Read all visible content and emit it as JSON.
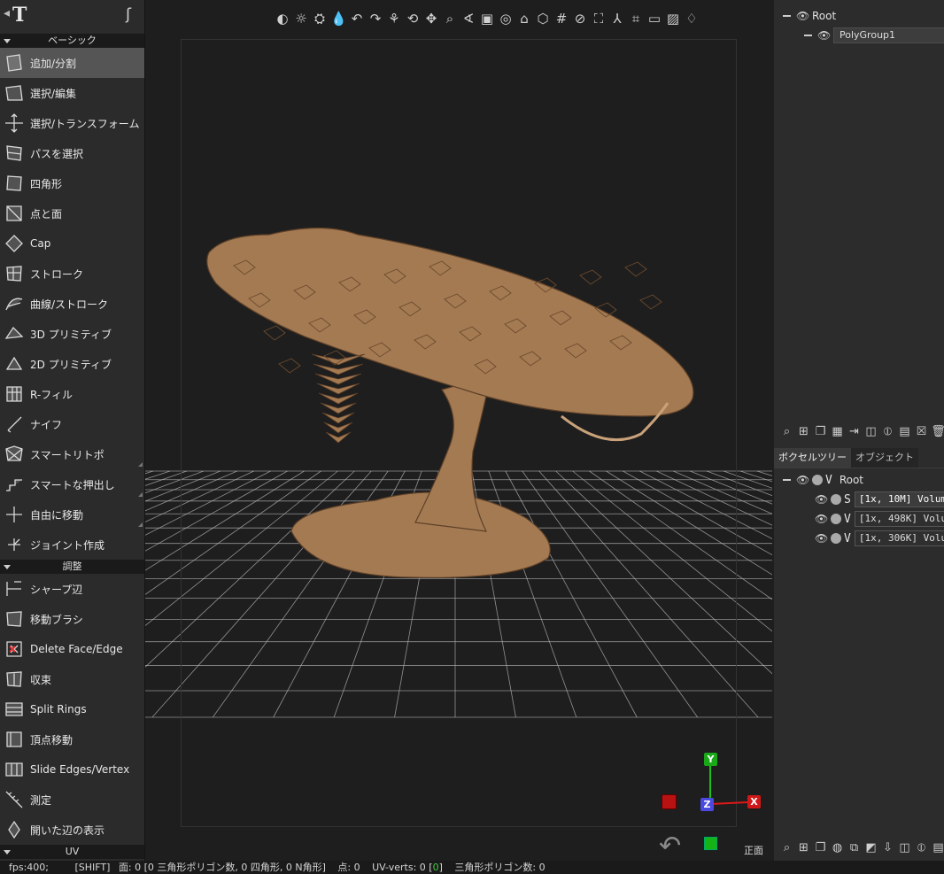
{
  "left_panel": {
    "sections": [
      {
        "title": "ベーシック",
        "tools": [
          {
            "label": "追加/分割",
            "icon": "add-split-icon",
            "active": true
          },
          {
            "label": "選択/編集",
            "icon": "select-edit-icon"
          },
          {
            "label": "選択/トランスフォーム",
            "icon": "transform-icon"
          },
          {
            "label": "パスを選択",
            "icon": "path-select-icon"
          },
          {
            "label": "四角形",
            "icon": "quad-icon"
          },
          {
            "label": "点と面",
            "icon": "points-faces-icon"
          },
          {
            "label": "Cap",
            "icon": "cap-icon"
          },
          {
            "label": "ストローク",
            "icon": "stroke-icon"
          },
          {
            "label": "曲線/ストローク",
            "icon": "curve-stroke-icon"
          },
          {
            "label": "3D プリミティブ",
            "icon": "primitive-3d-icon"
          },
          {
            "label": "2D プリミティブ",
            "icon": "primitive-2d-icon"
          },
          {
            "label": "R-フィル",
            "icon": "r-fill-icon"
          },
          {
            "label": "ナイフ",
            "icon": "knife-icon"
          },
          {
            "label": "スマートリトポ",
            "icon": "smart-retopo-icon"
          },
          {
            "label": "スマートな押出し",
            "icon": "smart-extrude-icon"
          },
          {
            "label": "自由に移動",
            "icon": "free-move-icon"
          },
          {
            "label": "ジョイント作成",
            "icon": "joint-icon"
          }
        ]
      },
      {
        "title": "調整",
        "tools": [
          {
            "label": "シャープ辺",
            "icon": "sharp-edge-icon"
          },
          {
            "label": "移動ブラシ",
            "icon": "move-brush-icon"
          },
          {
            "label": "Delete Face/Edge",
            "icon": "delete-face-icon"
          },
          {
            "label": "収束",
            "icon": "collapse-icon"
          },
          {
            "label": "Split Rings",
            "icon": "split-rings-icon"
          },
          {
            "label": "頂点移動",
            "icon": "vertex-move-icon"
          },
          {
            "label": "Slide Edges/Vertex",
            "icon": "slide-edges-icon"
          },
          {
            "label": "測定",
            "icon": "measure-icon"
          },
          {
            "label": "開いた辺の表示",
            "icon": "open-edges-icon"
          }
        ]
      },
      {
        "title": "UV",
        "tools": []
      }
    ]
  },
  "viewport": {
    "toolbar_icons": [
      "contrast-icon",
      "light-icon",
      "light-dir-icon",
      "drop-icon",
      "undo-rot-icon",
      "redo-rot-icon",
      "orbit-icon",
      "rotate-icon",
      "move-icon",
      "zoom-icon",
      "angle-icon",
      "frame-icon",
      "focus-icon",
      "home-icon",
      "cube-icon",
      "grid-icon",
      "render-icon",
      "fit-icon",
      "axes-icon",
      "corners-icon",
      "aspect-icon",
      "image-icon",
      "light-bulb-icon"
    ],
    "view_label": "正面",
    "gizmo": {
      "x": "X",
      "y": "Y",
      "z": "Z"
    },
    "colors": {
      "model": "#a47a52",
      "grid": "#b8b8b8",
      "x_axis": "#e01818",
      "y_axis": "#18c018",
      "z_axis": "#5a5af0"
    }
  },
  "poly_tree": {
    "root": "Root",
    "child": "PolyGroup1"
  },
  "tabs": [
    {
      "label": "ボクセルツリー",
      "active": true
    },
    {
      "label": "オブジェクト",
      "active": false
    }
  ],
  "voxel_tree": {
    "root_letter": "V",
    "root": "Root",
    "items": [
      {
        "letter": "S",
        "text": "[1x,  10M]  Volum",
        "selected": true
      },
      {
        "letter": "V",
        "text": "[1x,  498K]  Volu"
      },
      {
        "letter": "V",
        "text": "[1x,  306K]  Volu"
      }
    ]
  },
  "status": {
    "fps": "fps:400;",
    "shift": "[SHIFT]",
    "faces": "面:  0  [0  三角形ポリゴン数,  0  四角形,  0  N角形]",
    "points": "点:  0",
    "uv_verts_pre": "UV-verts:  0  [",
    "uv_verts_green": "0",
    "uv_verts_post": "]",
    "tri_count": "三角形ポリゴン数:  0"
  }
}
